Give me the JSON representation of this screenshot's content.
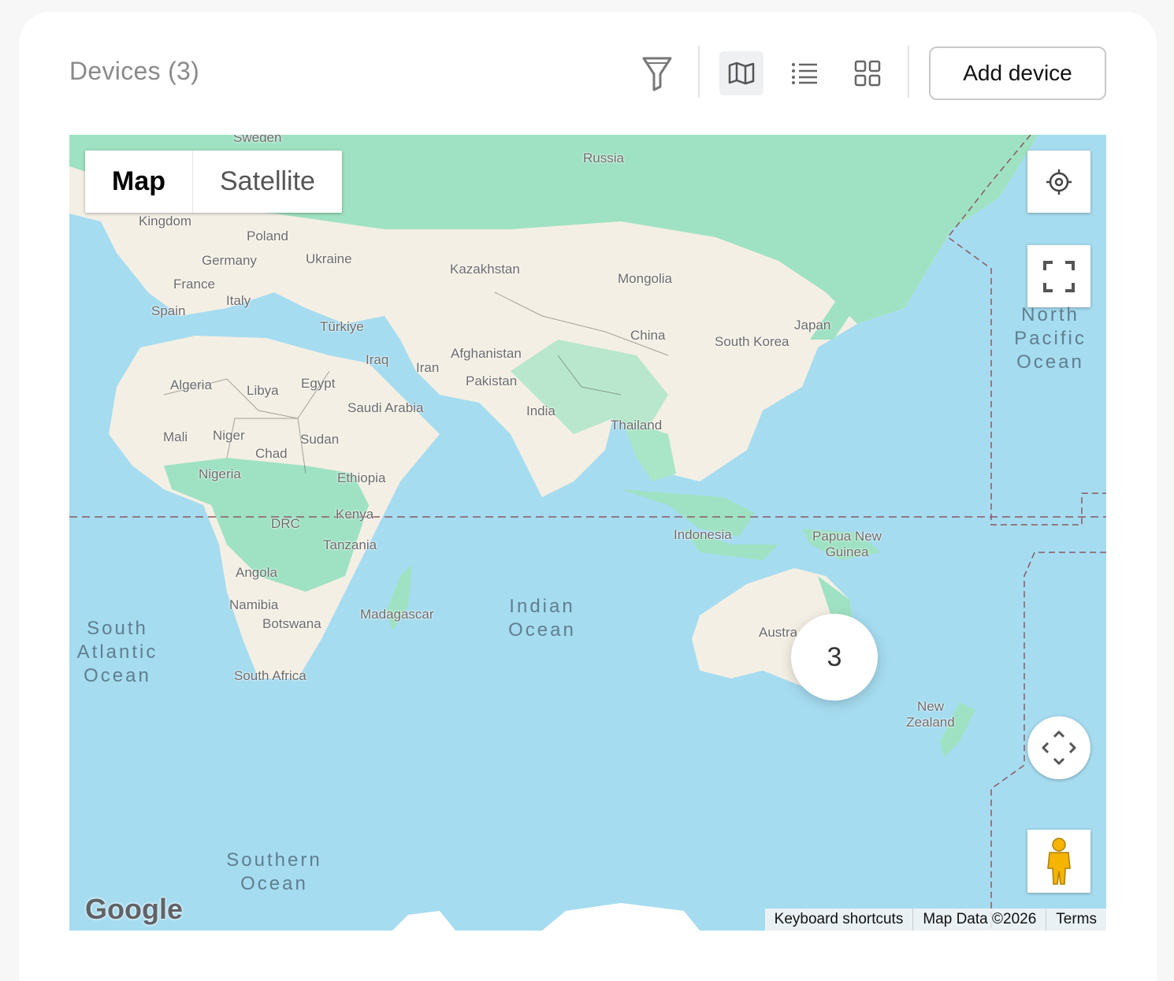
{
  "header": {
    "title": "Devices (3)",
    "add_button": "Add device",
    "view_modes": [
      "filter",
      "map",
      "list",
      "grid"
    ],
    "active_view": "map"
  },
  "map": {
    "type_toggle": {
      "map": "Map",
      "satellite": "Satellite",
      "selected": "Map"
    },
    "countries": [
      "Russia",
      "Sweden",
      "Kingdom",
      "Poland",
      "Germany",
      "Ukraine",
      "France",
      "Italy",
      "Spain",
      "Kazakhstan",
      "Mongolia",
      "Türkiye",
      "Japan",
      "China",
      "South Korea",
      "Iraq",
      "Iran",
      "Afghanistan",
      "Pakistan",
      "Algeria",
      "Libya",
      "Egypt",
      "Saudi Arabia",
      "India",
      "Thailand",
      "Mali",
      "Niger",
      "Sudan",
      "Chad",
      "Nigeria",
      "Ethiopia",
      "Kenya",
      "DRC",
      "Tanzania",
      "Indonesia",
      "Papua New Guinea",
      "Angola",
      "Namibia",
      "Madagascar",
      "Botswana",
      "South Africa",
      "Austra",
      "New Zealand"
    ],
    "oceans": {
      "north_pacific": "North\nPacific\nOcean",
      "indian": "Indian\nOcean",
      "south_atlantic": "South\nAtlantic\nOcean",
      "southern": "Southern\nOcean"
    },
    "cluster_count": "3",
    "logo": "Google",
    "attribution": [
      "Keyboard shortcuts",
      "Map Data ©2026",
      "Terms"
    ],
    "colors": {
      "water": "#a6dcf0",
      "land": "#f5f0e6",
      "forest": "#9be0c0"
    }
  }
}
